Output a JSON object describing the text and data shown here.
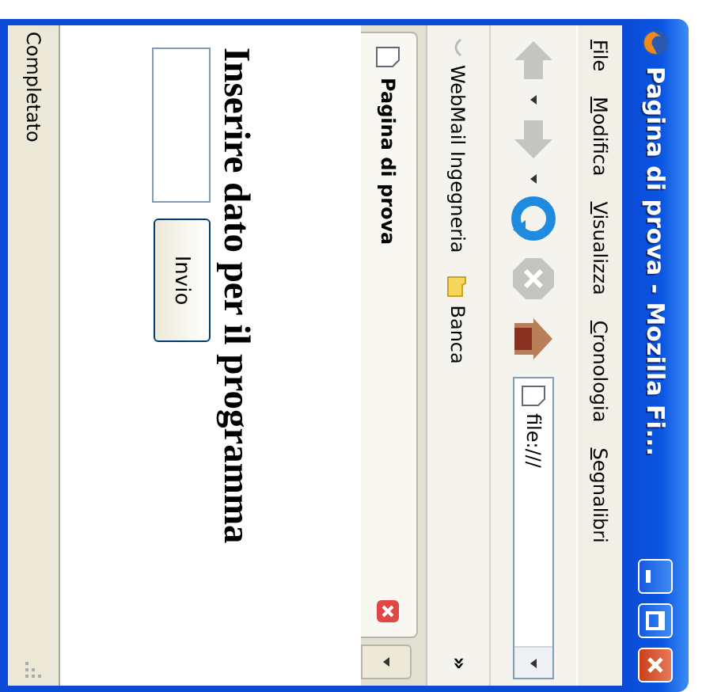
{
  "window": {
    "title": "Pagina di prova - Mozilla Fi..."
  },
  "menu": [
    "File",
    "Modifica",
    "Visualizza",
    "Cronologia",
    "Segnalibri"
  ],
  "nav_buttons": [
    {
      "kind": "back",
      "disabled": true
    },
    {
      "kind": "forward",
      "disabled": true
    },
    {
      "kind": "reload",
      "disabled": false
    },
    {
      "kind": "stop",
      "disabled": true
    },
    {
      "kind": "home",
      "disabled": false
    }
  ],
  "address": {
    "value": "file:///"
  },
  "bookmarks": [
    {
      "label": "WebMail Ingegneria",
      "kind": "link"
    },
    {
      "label": "Banca",
      "kind": "folder"
    }
  ],
  "bookmarks_overflow": "»",
  "tabs": [
    {
      "label": "Pagina di prova",
      "selected": true
    }
  ],
  "page": {
    "heading": "Inserire dato per il programma",
    "button": "Invio"
  },
  "status": "Completato"
}
